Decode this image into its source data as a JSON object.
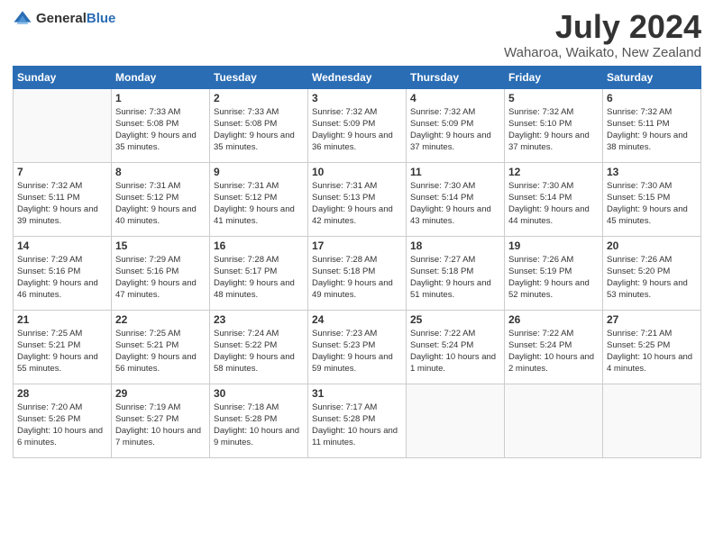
{
  "header": {
    "logo_general": "General",
    "logo_blue": "Blue",
    "month": "July 2024",
    "location": "Waharoa, Waikato, New Zealand"
  },
  "weekdays": [
    "Sunday",
    "Monday",
    "Tuesday",
    "Wednesday",
    "Thursday",
    "Friday",
    "Saturday"
  ],
  "weeks": [
    [
      {
        "day": "",
        "sunrise": "",
        "sunset": "",
        "daylight": ""
      },
      {
        "day": "1",
        "sunrise": "Sunrise: 7:33 AM",
        "sunset": "Sunset: 5:08 PM",
        "daylight": "Daylight: 9 hours and 35 minutes."
      },
      {
        "day": "2",
        "sunrise": "Sunrise: 7:33 AM",
        "sunset": "Sunset: 5:08 PM",
        "daylight": "Daylight: 9 hours and 35 minutes."
      },
      {
        "day": "3",
        "sunrise": "Sunrise: 7:32 AM",
        "sunset": "Sunset: 5:09 PM",
        "daylight": "Daylight: 9 hours and 36 minutes."
      },
      {
        "day": "4",
        "sunrise": "Sunrise: 7:32 AM",
        "sunset": "Sunset: 5:09 PM",
        "daylight": "Daylight: 9 hours and 37 minutes."
      },
      {
        "day": "5",
        "sunrise": "Sunrise: 7:32 AM",
        "sunset": "Sunset: 5:10 PM",
        "daylight": "Daylight: 9 hours and 37 minutes."
      },
      {
        "day": "6",
        "sunrise": "Sunrise: 7:32 AM",
        "sunset": "Sunset: 5:11 PM",
        "daylight": "Daylight: 9 hours and 38 minutes."
      }
    ],
    [
      {
        "day": "7",
        "sunrise": "Sunrise: 7:32 AM",
        "sunset": "Sunset: 5:11 PM",
        "daylight": "Daylight: 9 hours and 39 minutes."
      },
      {
        "day": "8",
        "sunrise": "Sunrise: 7:31 AM",
        "sunset": "Sunset: 5:12 PM",
        "daylight": "Daylight: 9 hours and 40 minutes."
      },
      {
        "day": "9",
        "sunrise": "Sunrise: 7:31 AM",
        "sunset": "Sunset: 5:12 PM",
        "daylight": "Daylight: 9 hours and 41 minutes."
      },
      {
        "day": "10",
        "sunrise": "Sunrise: 7:31 AM",
        "sunset": "Sunset: 5:13 PM",
        "daylight": "Daylight: 9 hours and 42 minutes."
      },
      {
        "day": "11",
        "sunrise": "Sunrise: 7:30 AM",
        "sunset": "Sunset: 5:14 PM",
        "daylight": "Daylight: 9 hours and 43 minutes."
      },
      {
        "day": "12",
        "sunrise": "Sunrise: 7:30 AM",
        "sunset": "Sunset: 5:14 PM",
        "daylight": "Daylight: 9 hours and 44 minutes."
      },
      {
        "day": "13",
        "sunrise": "Sunrise: 7:30 AM",
        "sunset": "Sunset: 5:15 PM",
        "daylight": "Daylight: 9 hours and 45 minutes."
      }
    ],
    [
      {
        "day": "14",
        "sunrise": "Sunrise: 7:29 AM",
        "sunset": "Sunset: 5:16 PM",
        "daylight": "Daylight: 9 hours and 46 minutes."
      },
      {
        "day": "15",
        "sunrise": "Sunrise: 7:29 AM",
        "sunset": "Sunset: 5:16 PM",
        "daylight": "Daylight: 9 hours and 47 minutes."
      },
      {
        "day": "16",
        "sunrise": "Sunrise: 7:28 AM",
        "sunset": "Sunset: 5:17 PM",
        "daylight": "Daylight: 9 hours and 48 minutes."
      },
      {
        "day": "17",
        "sunrise": "Sunrise: 7:28 AM",
        "sunset": "Sunset: 5:18 PM",
        "daylight": "Daylight: 9 hours and 49 minutes."
      },
      {
        "day": "18",
        "sunrise": "Sunrise: 7:27 AM",
        "sunset": "Sunset: 5:18 PM",
        "daylight": "Daylight: 9 hours and 51 minutes."
      },
      {
        "day": "19",
        "sunrise": "Sunrise: 7:26 AM",
        "sunset": "Sunset: 5:19 PM",
        "daylight": "Daylight: 9 hours and 52 minutes."
      },
      {
        "day": "20",
        "sunrise": "Sunrise: 7:26 AM",
        "sunset": "Sunset: 5:20 PM",
        "daylight": "Daylight: 9 hours and 53 minutes."
      }
    ],
    [
      {
        "day": "21",
        "sunrise": "Sunrise: 7:25 AM",
        "sunset": "Sunset: 5:21 PM",
        "daylight": "Daylight: 9 hours and 55 minutes."
      },
      {
        "day": "22",
        "sunrise": "Sunrise: 7:25 AM",
        "sunset": "Sunset: 5:21 PM",
        "daylight": "Daylight: 9 hours and 56 minutes."
      },
      {
        "day": "23",
        "sunrise": "Sunrise: 7:24 AM",
        "sunset": "Sunset: 5:22 PM",
        "daylight": "Daylight: 9 hours and 58 minutes."
      },
      {
        "day": "24",
        "sunrise": "Sunrise: 7:23 AM",
        "sunset": "Sunset: 5:23 PM",
        "daylight": "Daylight: 9 hours and 59 minutes."
      },
      {
        "day": "25",
        "sunrise": "Sunrise: 7:22 AM",
        "sunset": "Sunset: 5:24 PM",
        "daylight": "Daylight: 10 hours and 1 minute."
      },
      {
        "day": "26",
        "sunrise": "Sunrise: 7:22 AM",
        "sunset": "Sunset: 5:24 PM",
        "daylight": "Daylight: 10 hours and 2 minutes."
      },
      {
        "day": "27",
        "sunrise": "Sunrise: 7:21 AM",
        "sunset": "Sunset: 5:25 PM",
        "daylight": "Daylight: 10 hours and 4 minutes."
      }
    ],
    [
      {
        "day": "28",
        "sunrise": "Sunrise: 7:20 AM",
        "sunset": "Sunset: 5:26 PM",
        "daylight": "Daylight: 10 hours and 6 minutes."
      },
      {
        "day": "29",
        "sunrise": "Sunrise: 7:19 AM",
        "sunset": "Sunset: 5:27 PM",
        "daylight": "Daylight: 10 hours and 7 minutes."
      },
      {
        "day": "30",
        "sunrise": "Sunrise: 7:18 AM",
        "sunset": "Sunset: 5:28 PM",
        "daylight": "Daylight: 10 hours and 9 minutes."
      },
      {
        "day": "31",
        "sunrise": "Sunrise: 7:17 AM",
        "sunset": "Sunset: 5:28 PM",
        "daylight": "Daylight: 10 hours and 11 minutes."
      },
      {
        "day": "",
        "sunrise": "",
        "sunset": "",
        "daylight": ""
      },
      {
        "day": "",
        "sunrise": "",
        "sunset": "",
        "daylight": ""
      },
      {
        "day": "",
        "sunrise": "",
        "sunset": "",
        "daylight": ""
      }
    ]
  ]
}
